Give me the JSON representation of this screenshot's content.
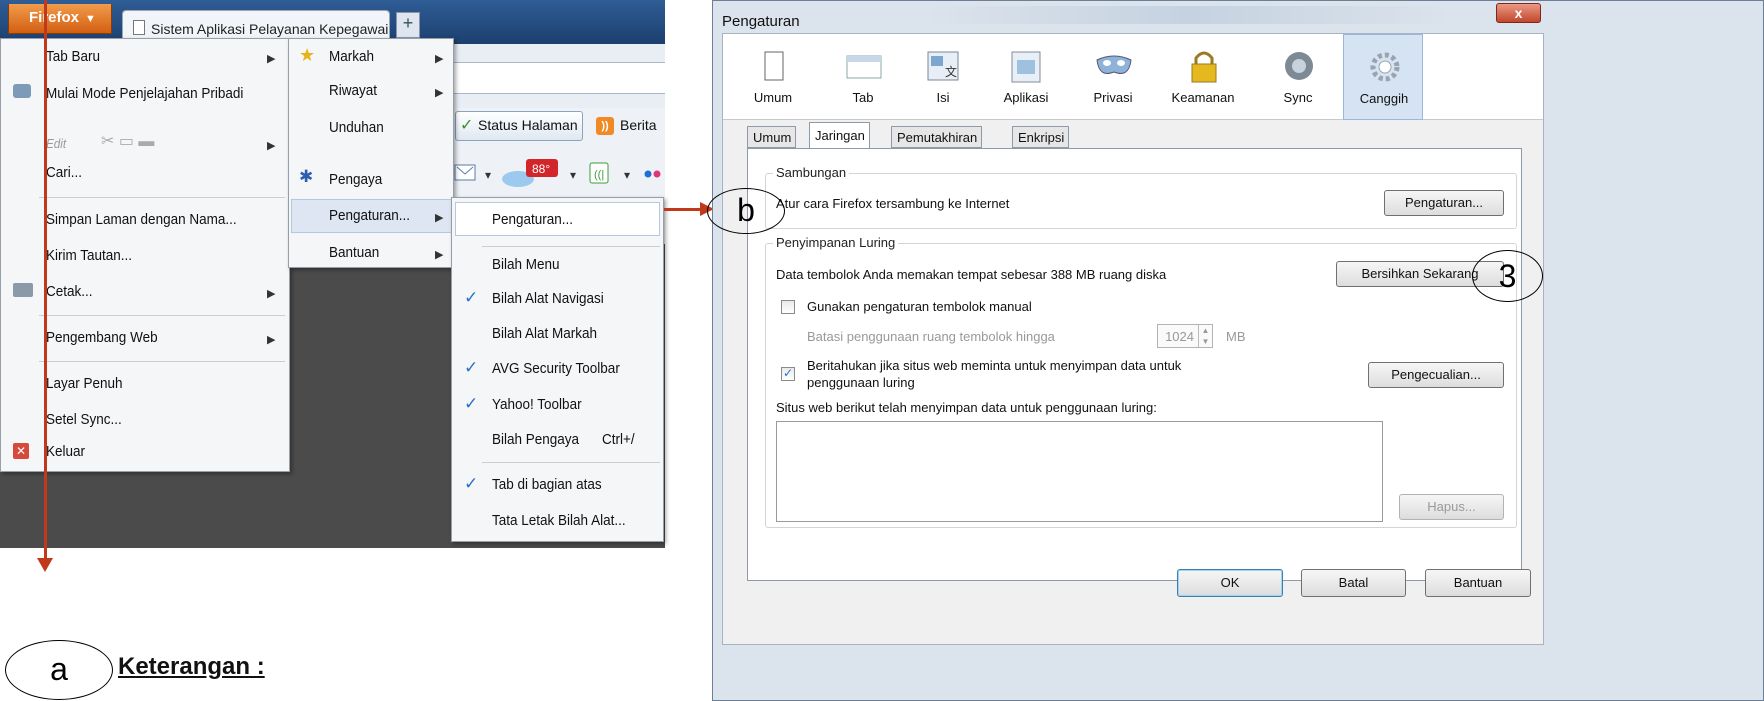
{
  "firefox": {
    "button_label": "Firefox",
    "tab_title": "Sistem Aplikasi Pelayanan Kepegawaian",
    "new_tab": "+",
    "toolbar": {
      "status": "Status Halaman",
      "berita": "Berita",
      "weather": "88°"
    },
    "menu_main": [
      "Tab Baru",
      "Mulai Mode Penjelajahan Pribadi",
      "Edit",
      "Cari...",
      "Simpan Laman dengan Nama...",
      "Kirim Tautan...",
      "Cetak...",
      "Pengembang Web",
      "Layar Penuh",
      "Setel Sync...",
      "Keluar"
    ],
    "menu_sub": [
      "Markah",
      "Riwayat",
      "Unduhan",
      "Pengaya",
      "Pengaturan...",
      "Bantuan"
    ],
    "menu_pengaturan": [
      "Pengaturan...",
      "Bilah Menu",
      "Bilah Alat Navigasi",
      "Bilah Alat Markah",
      "AVG Security Toolbar",
      "Yahoo! Toolbar",
      "Bilah Pengaya",
      "Tab di bagian atas",
      "Tata Letak Bilah Alat..."
    ],
    "shortcut_pengaya": "Ctrl+/"
  },
  "annotations": {
    "a": "a",
    "b": "b",
    "three": "3",
    "keterangan": "Keterangan :"
  },
  "dialog": {
    "title": "Pengaturan",
    "close": "x",
    "toolbar": [
      "Umum",
      "Tab",
      "Isi",
      "Aplikasi",
      "Privasi",
      "Keamanan",
      "Sync",
      "Canggih"
    ],
    "tabs": [
      "Umum",
      "Jaringan",
      "Pemutakhiran",
      "Enkripsi"
    ],
    "sambungan": {
      "legend": "Sambungan",
      "text": "Atur cara Firefox tersambung ke Internet",
      "button": "Pengaturan..."
    },
    "luring": {
      "legend": "Penyimpanan Luring",
      "cache_text": "Data tembolok Anda memakan tempat sebesar 388 MB ruang diska",
      "clear_button": "Bersihkan Sekarang",
      "manual_label": "Gunakan pengaturan tembolok manual",
      "limit_label": "Batasi penggunaan ruang tembolok hingga",
      "limit_value": "1024",
      "limit_unit": "MB",
      "notify_label_1": "Beritahukan jika situs web meminta untuk menyimpan data untuk",
      "notify_label_2": "penggunaan luring",
      "exceptions_button": "Pengecualian...",
      "list_label": "Situs web berikut telah menyimpan data untuk penggunaan luring:",
      "remove_button": "Hapus..."
    },
    "ok": "OK",
    "cancel": "Batal",
    "help": "Bantuan"
  }
}
